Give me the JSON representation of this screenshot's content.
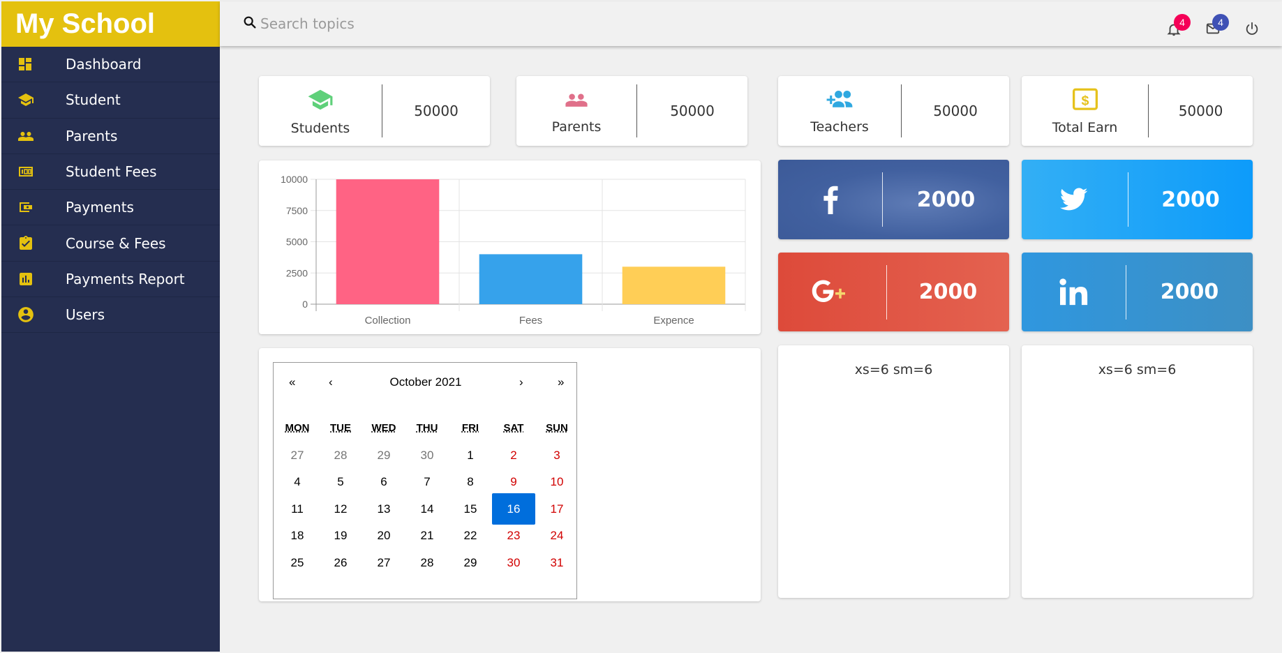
{
  "brand": "My School",
  "sidebar": {
    "items": [
      {
        "label": "Dashboard",
        "icon": "dashboard-icon"
      },
      {
        "label": "Student",
        "icon": "school-icon"
      },
      {
        "label": "Parents",
        "icon": "people-icon"
      },
      {
        "label": "Student Fees",
        "icon": "money-icon"
      },
      {
        "label": "Payments",
        "icon": "wallet-icon"
      },
      {
        "label": "Course & Fees",
        "icon": "assignment-icon"
      },
      {
        "label": "Payments Report",
        "icon": "report-icon"
      },
      {
        "label": "Users",
        "icon": "account-icon"
      }
    ],
    "icon_color": "#e4c10f"
  },
  "header": {
    "search_placeholder": "Search topics",
    "notifications_count": "4",
    "messages_count": "4"
  },
  "stats": [
    {
      "label": "Students",
      "value": "50000",
      "icon": "school-icon",
      "color": "#5fd07a"
    },
    {
      "label": "Parents",
      "value": "50000",
      "icon": "people-icon",
      "color": "#e0708a"
    },
    {
      "label": "Teachers",
      "value": "50000",
      "icon": "add-group-icon",
      "color": "#2fa8e0"
    },
    {
      "label": "Total Earn",
      "value": "50000",
      "icon": "dollar-icon",
      "color": "#e6c21c"
    }
  ],
  "social": [
    {
      "name": "facebook",
      "value": "2000",
      "icon": "facebook-icon",
      "color": "#405d9b"
    },
    {
      "name": "twitter",
      "value": "2000",
      "icon": "twitter-icon",
      "color": "#19a2fb"
    },
    {
      "name": "google-plus",
      "value": "2000",
      "icon": "google-plus-icon",
      "color": "#db4437"
    },
    {
      "name": "linkedin",
      "value": "2000",
      "icon": "linkedin-icon",
      "color": "#2b8fd5"
    }
  ],
  "grid_cells": [
    "xs=6 sm=6",
    "xs=6 sm=6"
  ],
  "chart_data": {
    "type": "bar",
    "categories": [
      "Collection",
      "Fees",
      "Expence"
    ],
    "values": [
      10000,
      4000,
      3000
    ],
    "colors": [
      "#ff6384",
      "#36a2eb",
      "#ffce56"
    ],
    "yticks": [
      "10000",
      "7500",
      "5000",
      "2500",
      "0"
    ],
    "ylim": [
      0,
      10000
    ],
    "grid": true,
    "title": "",
    "xlabel": "",
    "ylabel": ""
  },
  "calendar": {
    "title": "October 2021",
    "nav": [
      "«",
      "‹",
      "›",
      "»"
    ],
    "weekdays": [
      "MON",
      "TUE",
      "WED",
      "THU",
      "FRI",
      "SAT",
      "SUN"
    ],
    "weeks": [
      [
        "27",
        "28",
        "29",
        "30",
        "1",
        "2",
        "3"
      ],
      [
        "4",
        "5",
        "6",
        "7",
        "8",
        "9",
        "10"
      ],
      [
        "11",
        "12",
        "13",
        "14",
        "15",
        "16",
        "17"
      ],
      [
        "18",
        "19",
        "20",
        "21",
        "22",
        "23",
        "24"
      ],
      [
        "25",
        "26",
        "27",
        "28",
        "29",
        "30",
        "31"
      ]
    ],
    "selected_day": "16"
  }
}
